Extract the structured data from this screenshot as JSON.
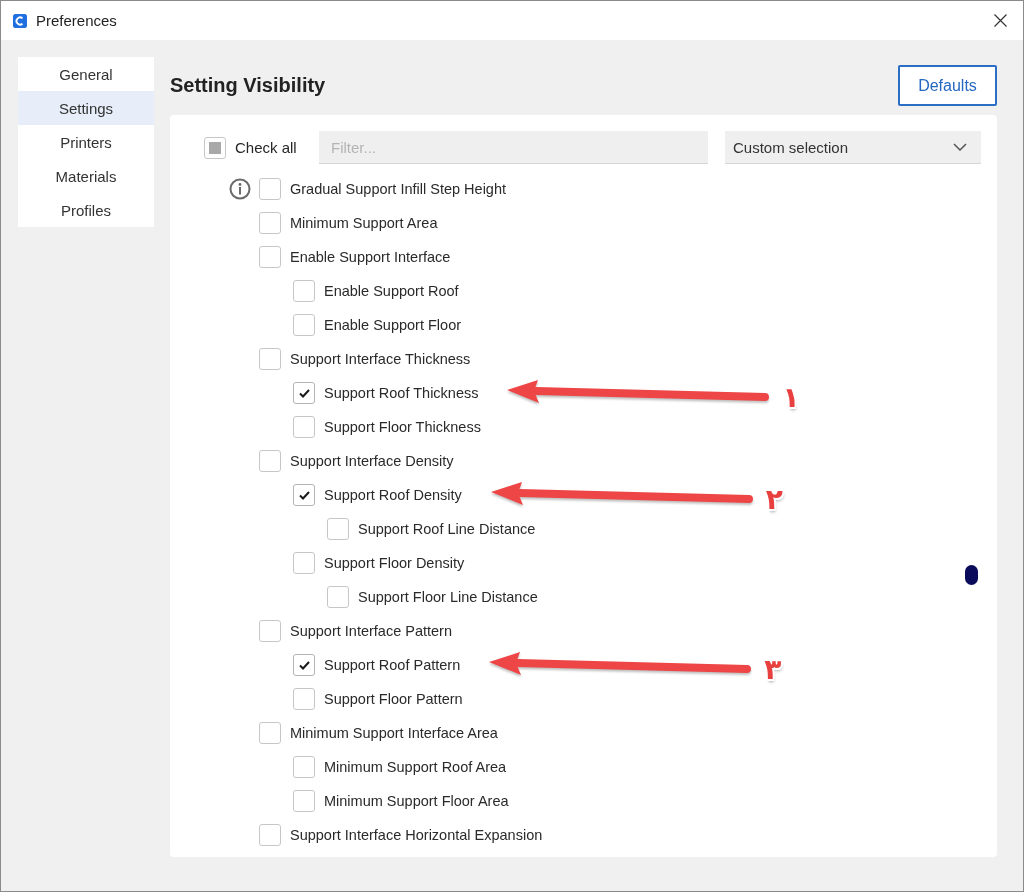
{
  "window": {
    "title": "Preferences"
  },
  "sidebar": {
    "items": [
      {
        "label": "General",
        "selected": false
      },
      {
        "label": "Settings",
        "selected": true
      },
      {
        "label": "Printers",
        "selected": false
      },
      {
        "label": "Materials",
        "selected": false
      },
      {
        "label": "Profiles",
        "selected": false
      }
    ]
  },
  "page": {
    "title": "Setting Visibility",
    "defaults_button": "Defaults"
  },
  "toolbar": {
    "check_all": {
      "label": "Check all",
      "checked": false,
      "indeterminate": true
    },
    "filter": {
      "placeholder": "Filter..."
    },
    "preset": {
      "value": "Custom selection"
    }
  },
  "settings": [
    {
      "label": "Gradual Support Infill Step Height",
      "checked": false,
      "hovered": true
    },
    {
      "label": "Minimum Support Area",
      "checked": false,
      "hovered": false
    },
    {
      "label": "Enable Support Interface",
      "checked": false,
      "hovered": false,
      "children": [
        {
          "label": "Enable Support Roof",
          "checked": false,
          "hovered": false
        },
        {
          "label": "Enable Support Floor",
          "checked": false,
          "hovered": false
        }
      ]
    },
    {
      "label": "Support Interface Thickness",
      "checked": false,
      "hovered": false,
      "children": [
        {
          "label": "Support Roof Thickness",
          "checked": true,
          "hovered": false,
          "annotation": "۱"
        },
        {
          "label": "Support Floor Thickness",
          "checked": false,
          "hovered": false
        }
      ]
    },
    {
      "label": "Support Interface Density",
      "checked": false,
      "hovered": false,
      "children": [
        {
          "label": "Support Roof Density",
          "checked": true,
          "hovered": false,
          "annotation": "۲",
          "children": [
            {
              "label": "Support Roof Line Distance",
              "checked": false,
              "hovered": false
            }
          ]
        },
        {
          "label": "Support Floor Density",
          "checked": false,
          "hovered": false,
          "children": [
            {
              "label": "Support Floor Line Distance",
              "checked": false,
              "hovered": false
            }
          ]
        }
      ]
    },
    {
      "label": "Support Interface Pattern",
      "checked": false,
      "hovered": false,
      "children": [
        {
          "label": "Support Roof Pattern",
          "checked": true,
          "hovered": false,
          "annotation": "۳"
        },
        {
          "label": "Support Floor Pattern",
          "checked": false,
          "hovered": false
        }
      ]
    },
    {
      "label": "Minimum Support Interface Area",
      "checked": false,
      "hovered": false,
      "children": [
        {
          "label": "Minimum Support Roof Area",
          "checked": false,
          "hovered": false
        },
        {
          "label": "Minimum Support Floor Area",
          "checked": false,
          "hovered": false
        }
      ]
    },
    {
      "label": "Support Interface Horizontal Expansion",
      "checked": false,
      "hovered": false
    }
  ]
}
